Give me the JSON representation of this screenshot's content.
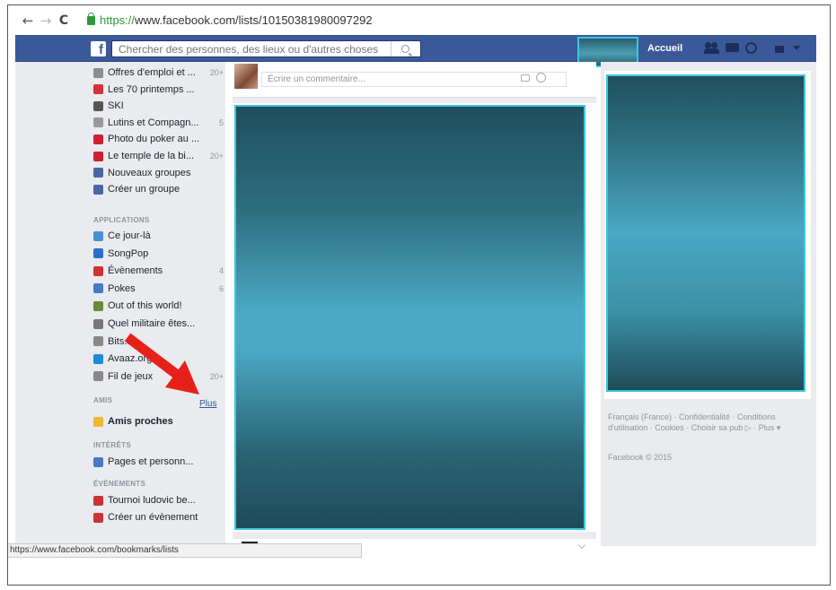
{
  "browser": {
    "back_glyph": "←",
    "forward_glyph": "→",
    "reload_glyph": "C",
    "url_https": "https://",
    "url_rest": "www.facebook.com/lists/10150381980097292"
  },
  "header": {
    "logo": "f",
    "search_placeholder": "Chercher des personnes, des lieux ou d'autres choses",
    "home_label": "Accueil"
  },
  "sidebar": {
    "items_top": [
      {
        "label": "Offres d'emploi et ...",
        "count": "20+",
        "icon": "briefcase-icon",
        "color": "#8a8d91"
      },
      {
        "label": "Les 70 printemps ...",
        "count": "",
        "icon": "gift-icon",
        "color": "#d6303c"
      },
      {
        "label": "SKI",
        "count": "",
        "icon": "group-photo-icon",
        "color": "#555"
      },
      {
        "label": "Lutins et Compagn...",
        "count": "5",
        "icon": "elf-icon",
        "color": "#999"
      },
      {
        "label": "Photo du poker au ...",
        "count": "",
        "icon": "cup-icon",
        "color": "#cf2030"
      },
      {
        "label": "Le temple de la bi...",
        "count": "20+",
        "icon": "cup-icon",
        "color": "#cf2030"
      },
      {
        "label": "Nouveaux groupes",
        "count": "",
        "icon": "groups-icon",
        "color": "#4c66a4"
      },
      {
        "label": "Créer un groupe",
        "count": "",
        "icon": "plus-icon",
        "color": "#4c66a4"
      }
    ],
    "applications_heading": "APPLICATIONS",
    "apps": [
      {
        "label": "Ce jour-là",
        "count": "",
        "icon": "clock-icon",
        "color": "#4a90d9"
      },
      {
        "label": "SongPop",
        "count": "",
        "icon": "songpop-icon",
        "color": "#2a6fc9"
      },
      {
        "label": "Évènements",
        "count": "4",
        "icon": "calendar-icon",
        "color": "#cc3333"
      },
      {
        "label": "Pokes",
        "count": "6",
        "icon": "poke-icon",
        "color": "#4a78c9"
      },
      {
        "label": "Out of this world!",
        "count": "",
        "icon": "game-icon",
        "color": "#6a8a3a"
      },
      {
        "label": "Quel militaire êtes...",
        "count": "",
        "icon": "quiz-icon",
        "color": "#777"
      },
      {
        "label": "Bits...s",
        "count": "",
        "icon": "chat-bubble-icon",
        "color": "#888"
      },
      {
        "label": "Avaaz.org",
        "count": "",
        "icon": "avaaz-icon",
        "color": "#1f8ad8"
      },
      {
        "label": "Fil de jeux",
        "count": "20+",
        "icon": "controller-icon",
        "color": "#888"
      }
    ],
    "friends_heading": "AMIS",
    "plus_link": "Plus",
    "friends": [
      {
        "label": "Amis proches",
        "count": "",
        "icon": "star-icon",
        "color": "#f2b632"
      }
    ],
    "interests_heading": "INTÉRÊTS",
    "interests": [
      {
        "label": "Pages et personn...",
        "count": "",
        "icon": "pages-icon",
        "color": "#4a78c9"
      }
    ],
    "events_heading": "ÉVÈNEMENTS",
    "events": [
      {
        "label": "Tournoi ludovic be...",
        "count": "",
        "icon": "calendar-icon",
        "color": "#cc3333"
      },
      {
        "label": "Créer un évènement",
        "count": "",
        "icon": "calendar-add-icon",
        "color": "#cc3333"
      }
    ]
  },
  "feed": {
    "comment_placeholder": "Écrire un commentaire..."
  },
  "footer": {
    "links": "Français (France) · Confidentialité · Conditions d'utilisation · Cookies · Choisir sa pub ▷ · Plus ▾",
    "copyright": "Facebook © 2015"
  },
  "status_bar": {
    "url": "https://www.facebook.com/bookmarks/lists"
  },
  "colors": {
    "facebook_blue": "#3b5998",
    "redaction_border": "#3ec4e0",
    "annotation_arrow": "#e8201a"
  }
}
